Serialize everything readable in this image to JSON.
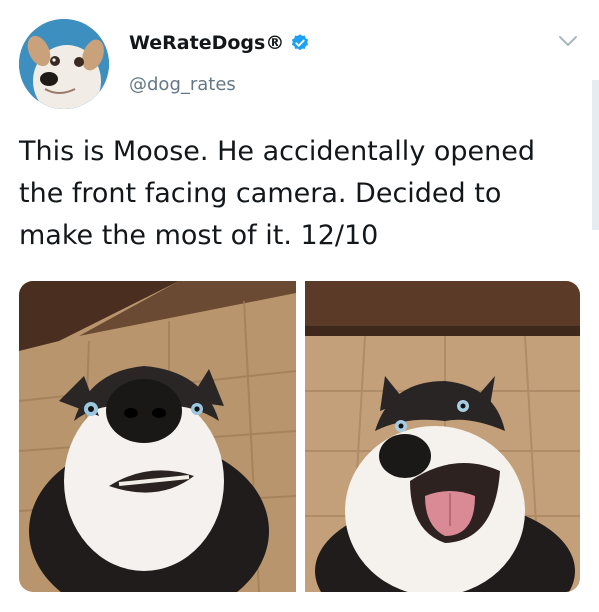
{
  "tweet": {
    "display_name": "WeRateDogs®",
    "handle": "@dog_rates",
    "verified": true,
    "text_lines": [
      "This is Moose. He accidentally opened",
      "the front facing camera. Decided to",
      "make the most of it. 12/10"
    ],
    "avatar_icon": "dog-avatar",
    "verified_icon": "verified-badge-icon",
    "menu_icon": "chevron-down-icon",
    "photos": [
      {
        "icon": "husky-photo-shocked"
      },
      {
        "icon": "husky-photo-smiling"
      }
    ]
  },
  "colors": {
    "text": "#14171a",
    "secondary": "#657786",
    "verified": "#1da1f2"
  }
}
